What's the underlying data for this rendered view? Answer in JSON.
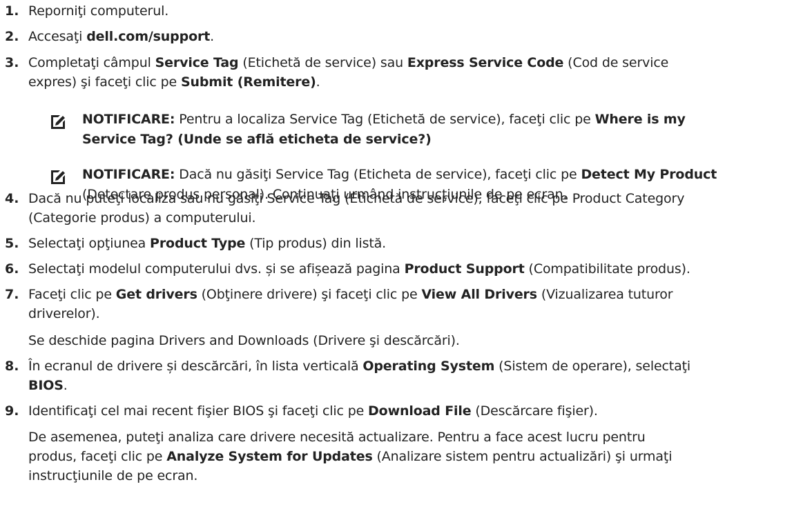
{
  "steps": [
    {
      "num": "1.",
      "lines": [
        [
          "Reporniţi computerul."
        ]
      ]
    },
    {
      "num": "2.",
      "lines": [
        [
          "Accesaţi ",
          "**dell.com/support",
          "."
        ]
      ]
    },
    {
      "num": "3.",
      "lines": [
        [
          "Completaţi câmpul ",
          "**Service Tag",
          " (Etichetă de service) sau ",
          "**Express Service Code",
          " (Cod de service"
        ],
        [
          "expres) şi faceţi clic pe ",
          "**Submit (Remitere)",
          "."
        ]
      ]
    },
    {
      "num": "4.",
      "lines": [
        [
          "Dacă nu puteţi localiza sau nu găsiţi Service Tag (Etichetă de service), faceţi clic pe Product Category"
        ],
        [
          "(Categorie produs) a computerului."
        ]
      ]
    },
    {
      "num": "5.",
      "lines": [
        [
          "Selectaţi opţiunea ",
          "**Product Type",
          " (Tip produs) din listă."
        ]
      ]
    },
    {
      "num": "6.",
      "lines": [
        [
          "Selectaţi modelul computerului dvs. și se afișează pagina ",
          "**Product Support",
          " (Compatibilitate produs)."
        ]
      ]
    },
    {
      "num": "7.",
      "lines": [
        [
          "Faceţi clic pe ",
          "**Get drivers",
          " (Obţinere drivere) şi faceţi clic pe ",
          "**View All Drivers",
          " (Vizualizarea tuturor"
        ],
        [
          "driverelor)."
        ],
        [
          "Se deschide pagina Drivers and Downloads (Drivere şi descărcări)."
        ]
      ]
    },
    {
      "num": "8.",
      "lines": [
        [
          "În ecranul de drivere și descărcări, în lista verticală ",
          "**Operating System",
          " (Sistem de operare), selectaţi"
        ],
        [
          "**BIOS",
          "."
        ]
      ]
    },
    {
      "num": "9.",
      "lines": [
        [
          "Identificaţi cel mai recent fişier BIOS şi faceţi clic pe ",
          "**Download File",
          " (Descărcare fişier)."
        ],
        [
          "De asemenea, puteţi analiza care drivere necesită actualizare. Pentru a face acest lucru pentru"
        ],
        [
          "produs, faceţi clic pe ",
          "**Analyze System for Updates",
          " (Analizare sistem pentru actualizări) şi urmaţi"
        ],
        [
          "instrucţiunile de pe ecran."
        ]
      ]
    }
  ],
  "notes": [
    {
      "icon": "pencil-note-icon",
      "lines": [
        [
          "NOTIFICARE:",
          " Pentru a localiza Service Tag (Etichetă de service), faceţi clic pe ",
          "**Where is my"
        ],
        [
          "**Service Tag? (Unde se află eticheta de service?)"
        ]
      ]
    },
    {
      "icon": "pencil-note-icon",
      "lines": [
        [
          "NOTIFICARE:",
          " Dacă nu găsiţi Service Tag (Eticheta de service), faceţi clic pe ",
          "**Detect My Product"
        ],
        [
          "(Detectare produs personal). Continuaţi urmând instrucţiunile de pe ecran."
        ]
      ]
    }
  ]
}
